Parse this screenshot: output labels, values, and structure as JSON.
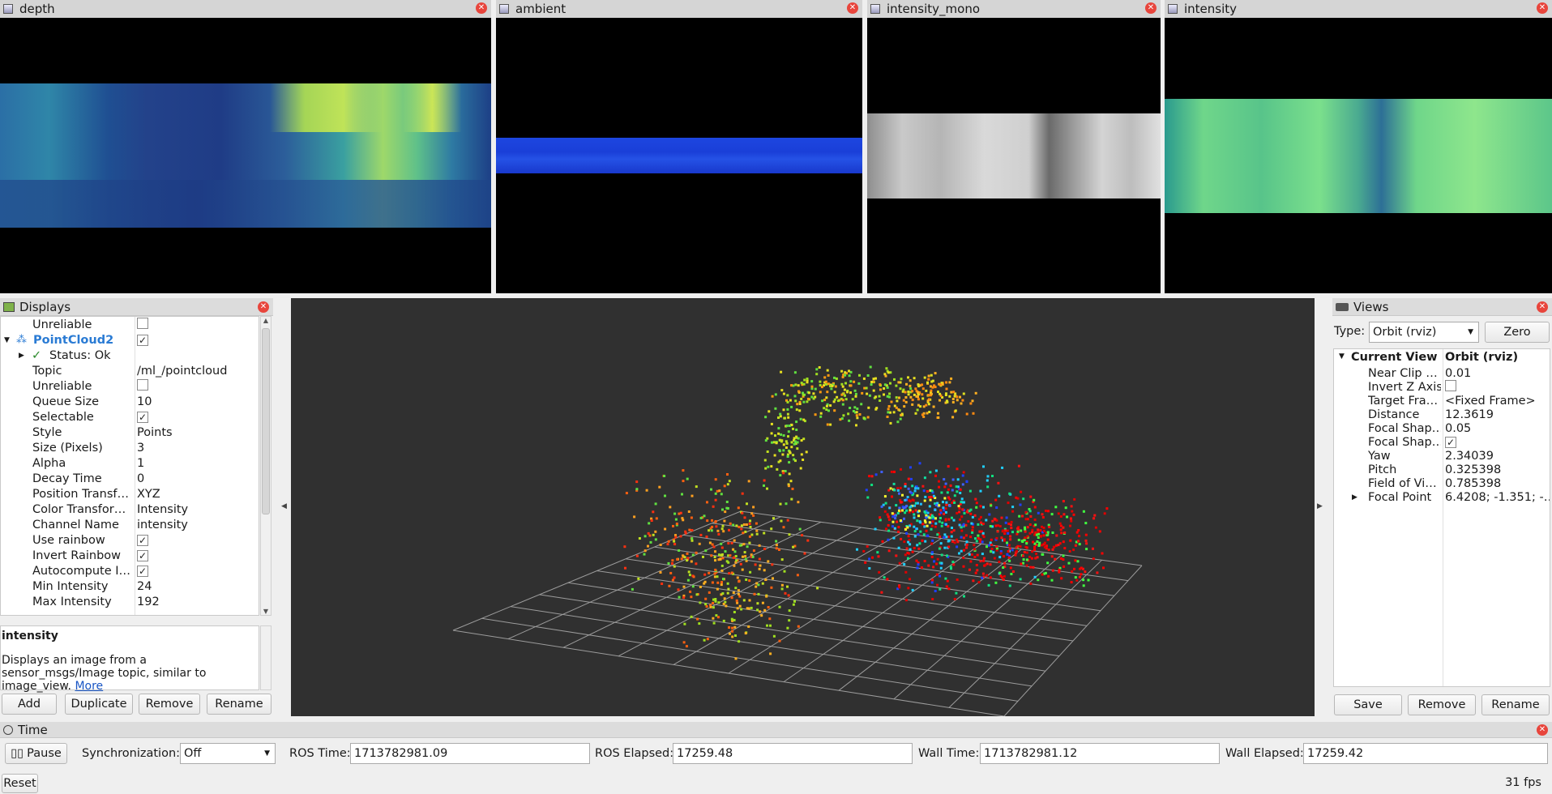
{
  "image_panels": [
    {
      "title": "depth",
      "icon": "image-icon"
    },
    {
      "title": "ambient",
      "icon": "image-icon"
    },
    {
      "title": "intensity_mono",
      "icon": "image-icon"
    },
    {
      "title": "intensity",
      "icon": "image-icon"
    }
  ],
  "displays": {
    "title": "Displays",
    "rows": [
      {
        "name": "Unreliable",
        "value": "",
        "check": "unchecked"
      },
      {
        "name": "PointCloud2",
        "value": "",
        "check": "checked"
      },
      {
        "name": "Status: Ok",
        "value": ""
      },
      {
        "name": "Topic",
        "value": "/ml_/pointcloud"
      },
      {
        "name": "Unreliable",
        "value": "",
        "check": "unchecked"
      },
      {
        "name": "Queue Size",
        "value": "10"
      },
      {
        "name": "Selectable",
        "value": "",
        "check": "checked"
      },
      {
        "name": "Style",
        "value": "Points"
      },
      {
        "name": "Size (Pixels)",
        "value": "3"
      },
      {
        "name": "Alpha",
        "value": "1"
      },
      {
        "name": "Decay Time",
        "value": "0"
      },
      {
        "name": "Position Transf…",
        "value": "XYZ"
      },
      {
        "name": "Color Transfor…",
        "value": "Intensity"
      },
      {
        "name": "Channel Name",
        "value": "intensity"
      },
      {
        "name": "Use rainbow",
        "value": "",
        "check": "checked"
      },
      {
        "name": "Invert Rainbow",
        "value": "",
        "check": "checked"
      },
      {
        "name": "Autocompute I…",
        "value": "",
        "check": "checked"
      },
      {
        "name": "Min Intensity",
        "value": "24"
      },
      {
        "name": "Max Intensity",
        "value": "192"
      }
    ],
    "desc_title": "intensity",
    "desc_text": "Displays an image from a sensor_msgs/Image topic, similar to image_view.",
    "desc_link": "More",
    "buttons": {
      "add": "Add",
      "duplicate": "Duplicate",
      "remove": "Remove",
      "rename": "Rename"
    }
  },
  "views": {
    "title": "Views",
    "type_label": "Type:",
    "type_value": "Orbit (rviz)",
    "zero_label": "Zero",
    "header_name": "Current View",
    "header_value": "Orbit (rviz)",
    "rows": [
      {
        "name": "Near Clip …",
        "value": "0.01"
      },
      {
        "name": "Invert Z Axis",
        "value": "",
        "check": "unchecked"
      },
      {
        "name": "Target Fra…",
        "value": "<Fixed Frame>"
      },
      {
        "name": "Distance",
        "value": "12.3619"
      },
      {
        "name": "Focal Shap…",
        "value": "0.05"
      },
      {
        "name": "Focal Shap…",
        "value": "",
        "check": "checked"
      },
      {
        "name": "Yaw",
        "value": "2.34039"
      },
      {
        "name": "Pitch",
        "value": "0.325398"
      },
      {
        "name": "Field of Vi…",
        "value": "0.785398"
      },
      {
        "name": "Focal Point",
        "value": "6.4208; -1.351; -…"
      }
    ],
    "buttons": {
      "save": "Save",
      "remove": "Remove",
      "rename": "Rename"
    }
  },
  "time": {
    "title": "Time",
    "pause_label": "Pause",
    "sync_label": "Synchronization:",
    "sync_value": "Off",
    "ros_time_label": "ROS Time:",
    "ros_time": "1713782981.09",
    "ros_elapsed_label": "ROS Elapsed:",
    "ros_elapsed": "17259.48",
    "wall_time_label": "Wall Time:",
    "wall_time": "1713782981.12",
    "wall_elapsed_label": "Wall Elapsed:",
    "wall_elapsed": "17259.42"
  },
  "status": {
    "reset_label": "Reset",
    "fps": "31 fps"
  },
  "colors": {
    "viewport_bg": "#303030",
    "grid": "#a0a0a0",
    "link": "#1a56c4",
    "pointcloud_label": "#2a7bd4"
  }
}
